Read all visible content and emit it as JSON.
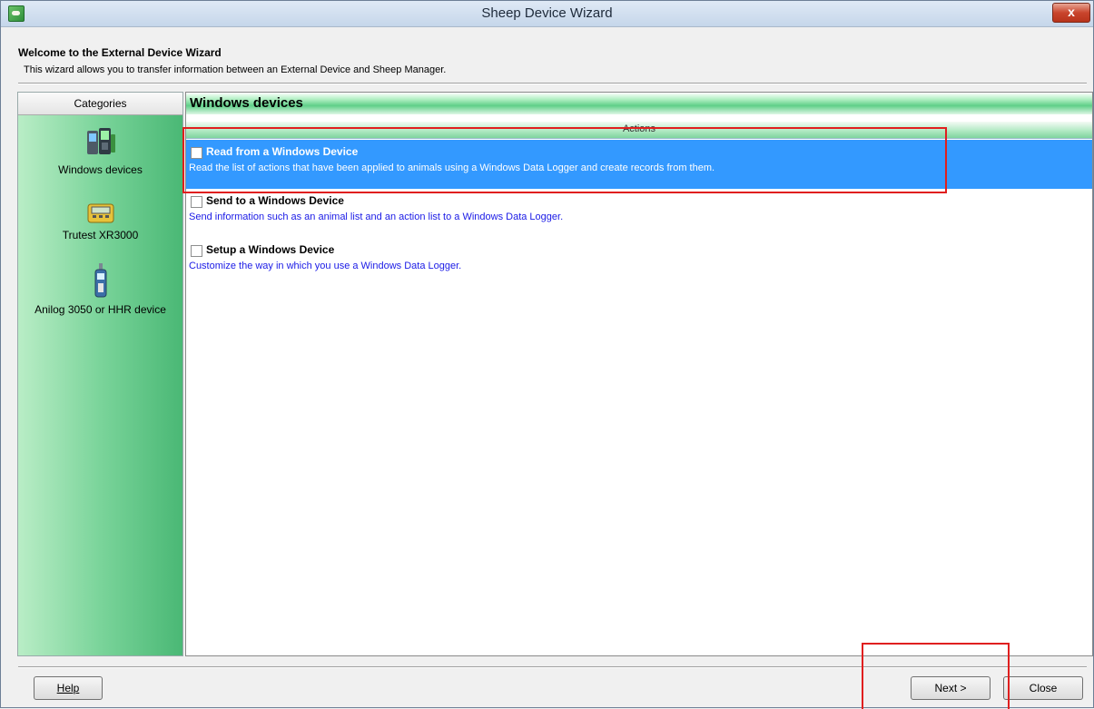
{
  "window": {
    "title": "Sheep Device Wizard",
    "close_glyph": "x"
  },
  "header": {
    "title": "Welcome to the External Device Wizard",
    "description": "This wizard allows you to transfer information between an External Device and Sheep Manager."
  },
  "sidebar": {
    "heading": "Categories",
    "items": [
      {
        "label": "Windows devices",
        "icon": "handheld-devices-icon"
      },
      {
        "label": "Trutest XR3000",
        "icon": "scale-indicator-icon"
      },
      {
        "label": "Anilog 3050 or HHR device",
        "icon": "handheld-reader-icon"
      }
    ]
  },
  "main": {
    "heading": "Windows devices",
    "column_header": "Actions",
    "actions": [
      {
        "title": "Read from a Windows Device",
        "description": "Read the list of actions that have been applied to animals using a Windows Data Logger and create records from them.",
        "checked": false,
        "selected": true
      },
      {
        "title": "Send to a Windows Device",
        "description": "Send information such as an animal list and an action list to a Windows Data Logger.",
        "checked": false,
        "selected": false
      },
      {
        "title": "Setup a Windows Device",
        "description": "Customize the way in which you use a Windows Data Logger.",
        "checked": false,
        "selected": false
      }
    ]
  },
  "footer": {
    "help_label": "Help",
    "next_label": "Next >",
    "close_label": "Close"
  },
  "colors": {
    "selection": "#3399ff",
    "highlight_box": "#e01f1f",
    "category_green": "#4ab875"
  }
}
